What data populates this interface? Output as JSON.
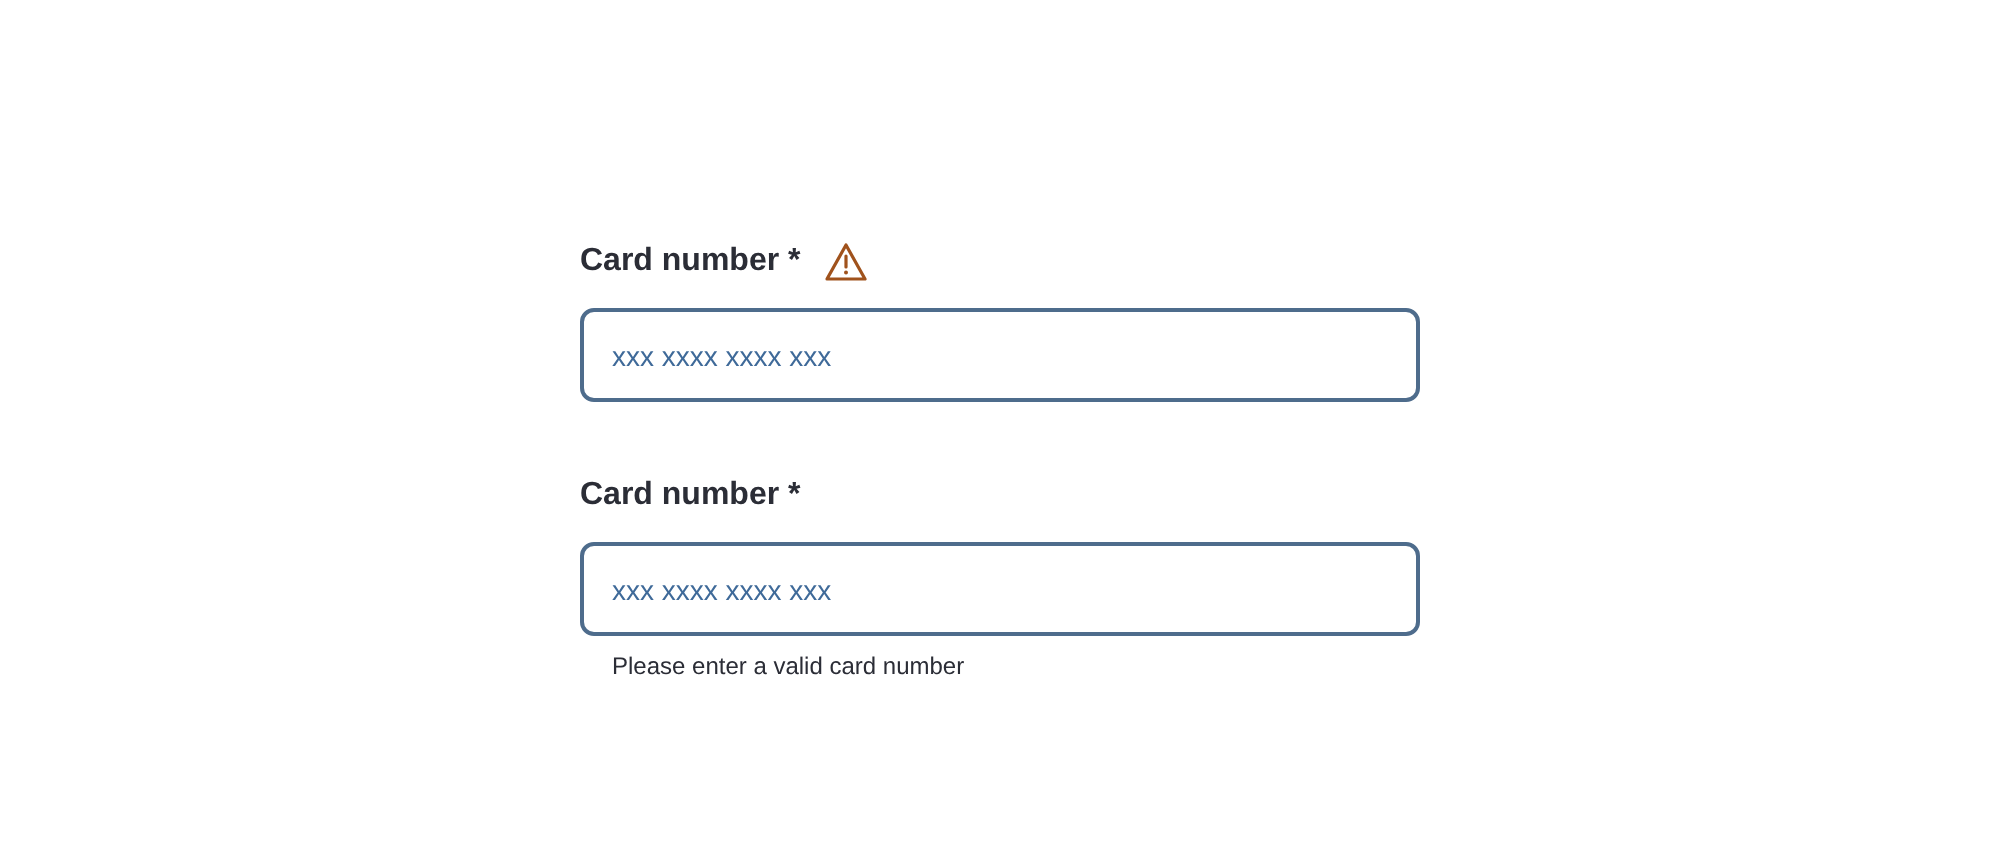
{
  "fields": [
    {
      "label": "Card number *",
      "warning": true,
      "placeholder": "xxx xxxx xxxx xxx"
    },
    {
      "label": "Card number *",
      "warning": false,
      "placeholder": "xxx xxxx xxxx xxx",
      "helper": "Please enter a valid card number"
    }
  ]
}
